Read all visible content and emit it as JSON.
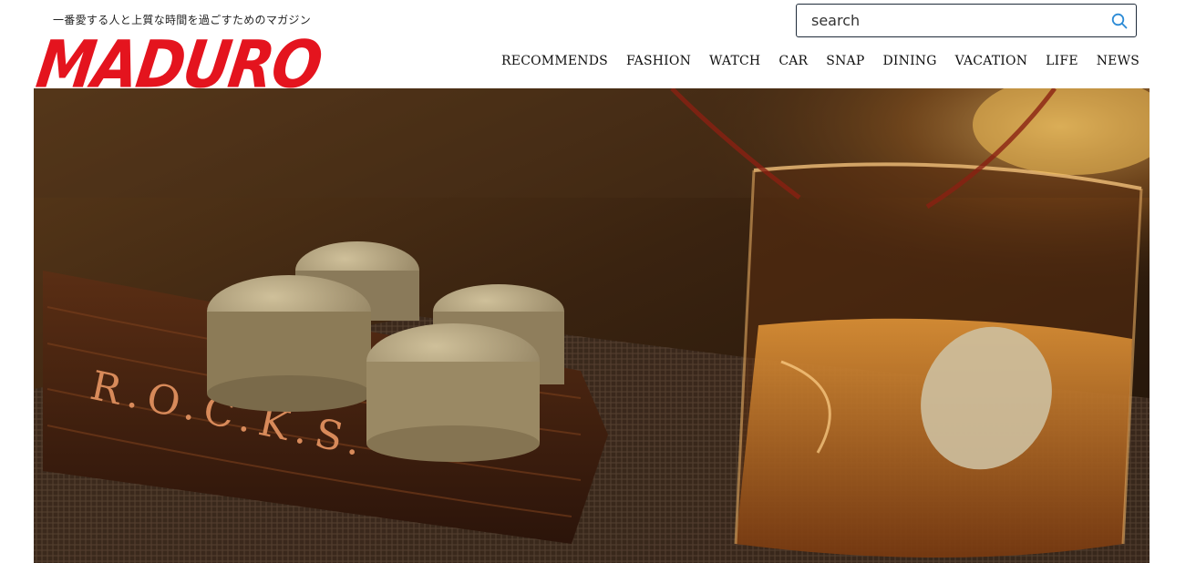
{
  "header": {
    "tagline": "一番愛する人と上質な時間を過ごすためのマガジン",
    "logo": "MADURO",
    "logo_color": "#e4141e"
  },
  "search": {
    "placeholder": "search",
    "icon": "search-icon",
    "accent": "#2c8bd6"
  },
  "nav": {
    "items": [
      "RECOMMENDS",
      "FASHION",
      "WATCH",
      "CAR",
      "SNAP",
      "DINING",
      "VACATION",
      "LIFE",
      "NEWS"
    ]
  },
  "hero": {
    "image": "whisky-stones-photo",
    "engraving": "R.O.C.K.S."
  }
}
